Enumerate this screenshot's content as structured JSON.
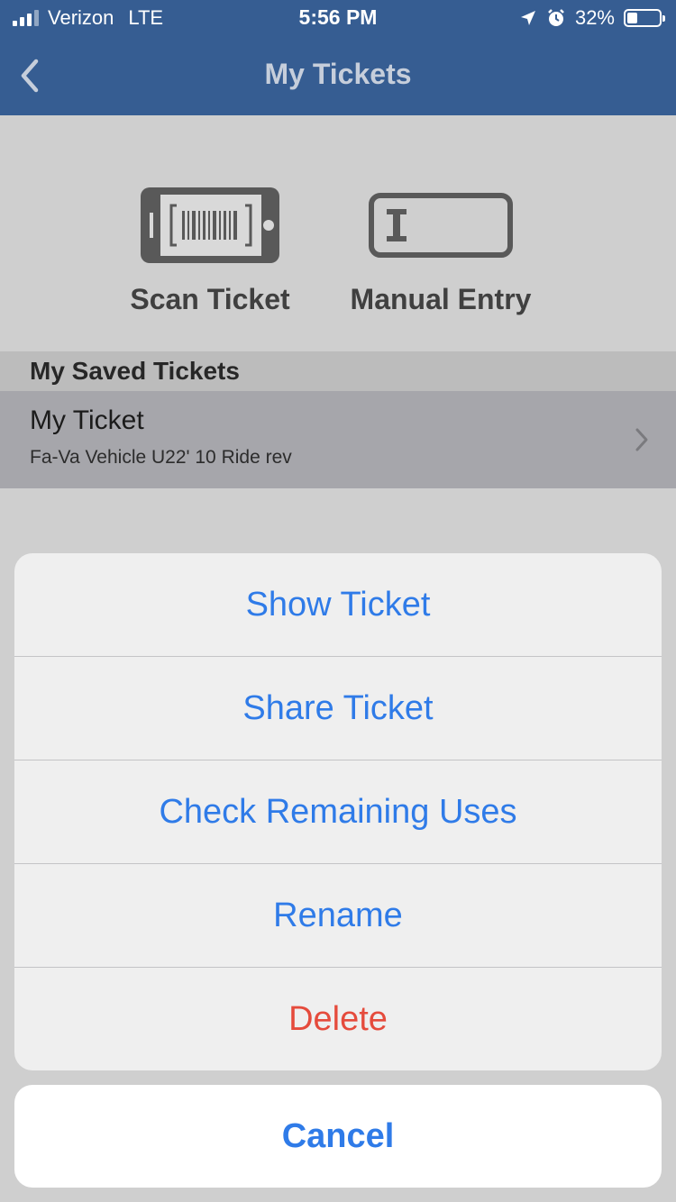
{
  "status_bar": {
    "carrier": "Verizon",
    "network": "LTE",
    "time": "5:56 PM",
    "battery": "32%",
    "battery_level": 0.32
  },
  "nav": {
    "title": "My Tickets",
    "back_icon": "chevron-left-icon"
  },
  "actions": {
    "scan_label": "Scan Ticket",
    "scan_icon": "phone-barcode-icon",
    "manual_label": "Manual Entry",
    "manual_icon": "text-field-icon"
  },
  "saved": {
    "header": "My Saved Tickets",
    "tickets": [
      {
        "name": "My Ticket",
        "description": "Fa-Va Vehicle U22' 10 Ride rev"
      }
    ]
  },
  "action_sheet": {
    "items": [
      {
        "label": "Show Ticket"
      },
      {
        "label": "Share Ticket"
      },
      {
        "label": "Check Remaining Uses"
      },
      {
        "label": "Rename"
      },
      {
        "label": "Delete"
      }
    ],
    "cancel": "Cancel"
  },
  "colors": {
    "nav_bg": "#365d92",
    "action_blue": "#2f7be8",
    "destructive_red": "#e54b3c"
  }
}
